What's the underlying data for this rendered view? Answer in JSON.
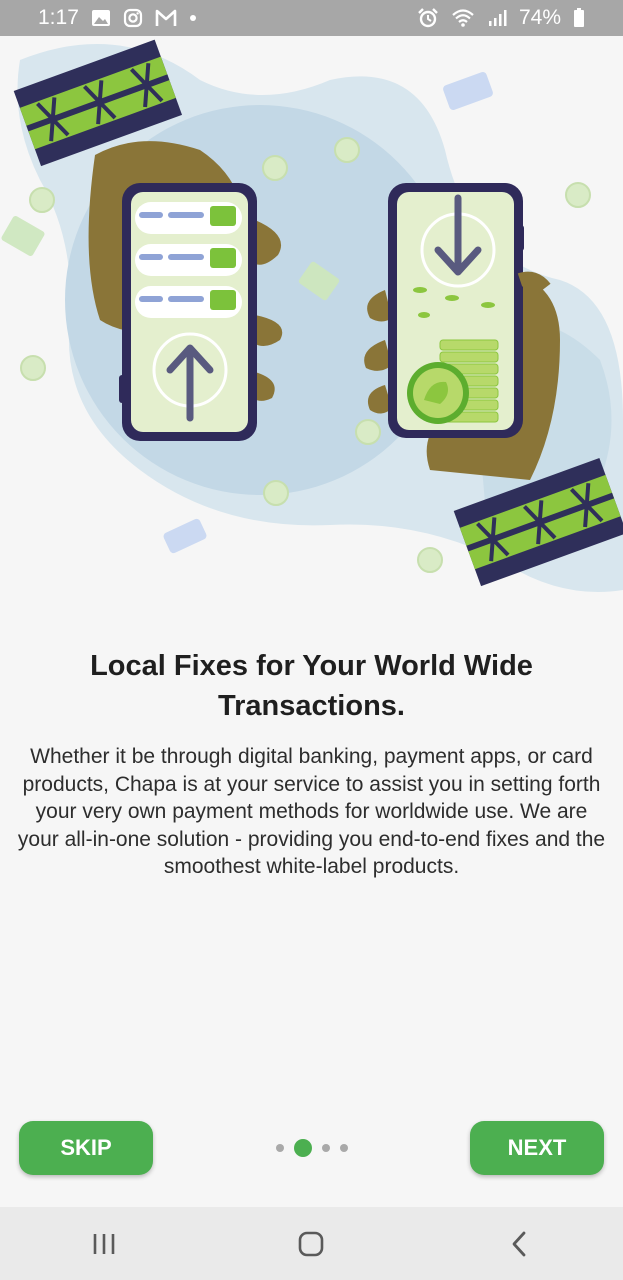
{
  "status_bar": {
    "time": "1:17",
    "battery": "74%",
    "left_icons": [
      "gallery-icon",
      "instagram-icon",
      "gmail-icon",
      "notification-dot-icon"
    ],
    "right_icons": [
      "alarm-icon",
      "wifi-icon",
      "signal-icon",
      "battery-icon"
    ]
  },
  "onboarding": {
    "title": "Local Fixes for Your World Wide Transactions.",
    "description": "Whether it be through digital banking, payment apps, or card products, Chapa is at your service to assist you in setting forth your very own payment methods for worldwide use. We are your all-in-one solution - providing you end-to-end fixes and the smoothest white-label products.",
    "skip_label": "SKIP",
    "next_label": "NEXT",
    "page_count": 4,
    "active_page": 2
  },
  "colors": {
    "accent": "#4caf50",
    "status_bar": "#a7a7a7",
    "nav_bar": "#eaeaea",
    "background": "#f6f6f6"
  },
  "nav_bar": {
    "icons": [
      "recent-apps-icon",
      "home-icon",
      "back-icon"
    ]
  }
}
